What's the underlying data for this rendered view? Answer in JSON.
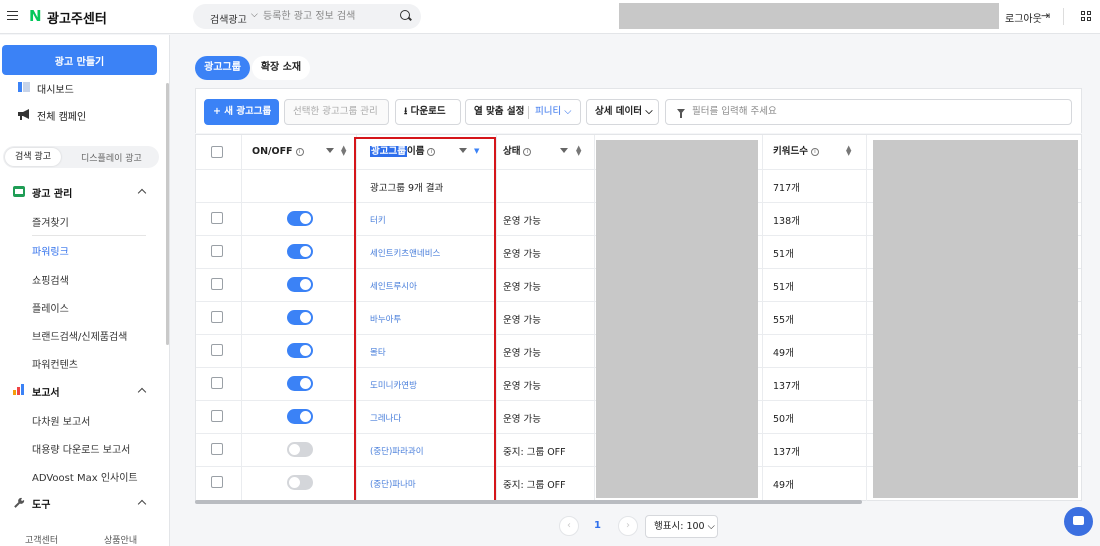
{
  "header": {
    "brand_logo": "N",
    "title": "광고주센터",
    "search_type": "검색광고",
    "search_placeholder": "등록한 광고 정보 검색",
    "logout_label": "로그아웃"
  },
  "sidebar": {
    "create_button": "광고 만들기",
    "dashboard": "대시보드",
    "all_campaigns": "전체 캠페인",
    "segment": {
      "active": "검색 광고",
      "inactive": "디스플레이 광고"
    },
    "ad_management": {
      "title": "광고 관리",
      "items": [
        "즐겨찾기",
        "파워링크",
        "쇼핑검색",
        "플레이스",
        "브랜드검색/신제품검색",
        "파워컨텐츠"
      ],
      "active_index": 1
    },
    "reports": {
      "title": "보고서",
      "items": [
        "다차원 보고서",
        "대용량 다운로드 보고서",
        "ADVoost Max 인사이트"
      ]
    },
    "tools": {
      "title": "도구"
    },
    "footer": {
      "support": "고객센터",
      "product_info": "상품안내"
    }
  },
  "tabs": {
    "ad_group": "광고그룹",
    "extension": "확장 소재"
  },
  "toolbar": {
    "new_group": "+ 새 광고그룹",
    "selected_manage": "선택한 광고그룹 관리",
    "download": "다운로드",
    "fit_setting": "열 맞춤 설정",
    "fit_value": "피니티",
    "detail_data": "상세 데이터",
    "filter_placeholder": "필터를 입력해 주세요"
  },
  "table": {
    "headers": {
      "onoff": "ON/OFF",
      "name_highlight": "광고그룹",
      "name_rest": "이름",
      "status": "상태",
      "keywords": "키워드수"
    },
    "summary": {
      "name": "광고그룹 9개 결과",
      "keywords": "717개"
    },
    "rows": [
      {
        "on": true,
        "name": "터키",
        "status": "운영 가능",
        "keywords": "138개"
      },
      {
        "on": true,
        "name": "세인트키츠앤네비스",
        "status": "운영 가능",
        "keywords": "51개"
      },
      {
        "on": true,
        "name": "세인트루시아",
        "status": "운영 가능",
        "keywords": "51개"
      },
      {
        "on": true,
        "name": "바누아투",
        "status": "운영 가능",
        "keywords": "55개"
      },
      {
        "on": true,
        "name": "몰타",
        "status": "운영 가능",
        "keywords": "49개"
      },
      {
        "on": true,
        "name": "도미니카연방",
        "status": "운영 가능",
        "keywords": "137개"
      },
      {
        "on": true,
        "name": "그레나다",
        "status": "운영 가능",
        "keywords": "50개"
      },
      {
        "on": false,
        "name": "(중단)파라과이",
        "status": "중지: 그룹 OFF",
        "keywords": "137개"
      },
      {
        "on": false,
        "name": "(중단)파나마",
        "status": "중지: 그룹 OFF",
        "keywords": "49개"
      }
    ]
  },
  "pagination": {
    "current": "1",
    "page_size": "행표시: 100"
  },
  "colors": {
    "accent": "#3b82f6",
    "highlight_border": "#d5151a",
    "brand_green": "#03c75a"
  }
}
